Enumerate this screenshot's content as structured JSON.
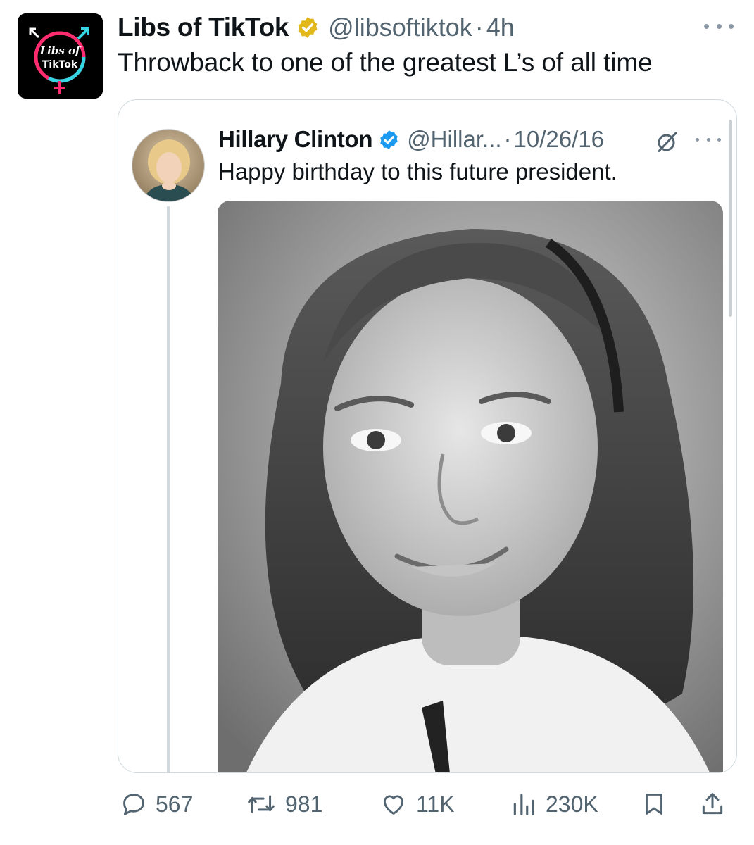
{
  "tweet": {
    "author_name": "Libs of TikTok",
    "handle": "@libsoftiktok",
    "separator": "·",
    "time": "4h",
    "text": "Throwback to one of the greatest L’s of all time",
    "avatar_text_line1": "Libs of",
    "avatar_text_line2": "TikTok",
    "verified_badge": "gold-verified-badge-icon"
  },
  "quote": {
    "author_name": "Hillary Clinton",
    "handle": "@Hillar...",
    "separator": "·",
    "time": "10/26/16",
    "text": "Happy birthday to this future president.",
    "verified_badge": "blue-verified-badge-icon",
    "media_description_icon": "photo"
  },
  "actions": {
    "reply_count": "567",
    "repost_count": "981",
    "like_count": "11K",
    "views_count": "230K"
  },
  "colors": {
    "text_primary": "#0f1419",
    "text_secondary": "#536471",
    "border": "#cfd9de",
    "verified_gold": "#e2b719",
    "verified_blue": "#1d9bf0"
  }
}
